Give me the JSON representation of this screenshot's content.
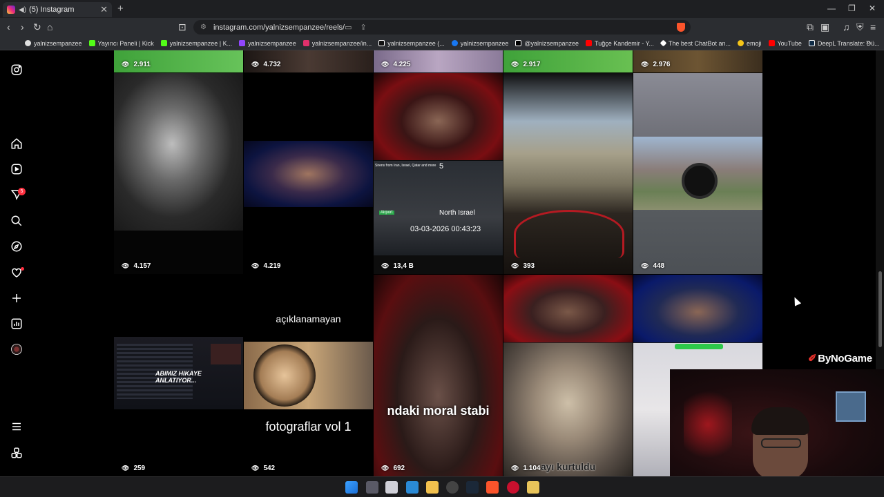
{
  "browser": {
    "tab_title": "(5) Instagram",
    "new_tab": "+",
    "url": "instagram.com/yalnizsempanzee/reels/",
    "window_controls": [
      "—",
      "❐",
      "✕"
    ],
    "bookmarks": [
      {
        "label": "yalnizsempanzee",
        "color": "#e0e0e0"
      },
      {
        "label": "Yayıncı Paneli | Kick",
        "color": "#53fc18"
      },
      {
        "label": "yalnizsempanzee | K...",
        "color": "#53fc18"
      },
      {
        "label": "yalnizsempanzee",
        "color": "#9146ff"
      },
      {
        "label": "yalnizsempanzee/in...",
        "color": "#e1306c"
      },
      {
        "label": "yalnizsempanzee (...",
        "color": "#ffffff"
      },
      {
        "label": "yalnizsempanzee",
        "color": "#1877f2"
      },
      {
        "label": "@yalnizsempanzee",
        "color": "#ffffff"
      },
      {
        "label": "Tuğçe Kandemir - Y...",
        "color": "#ff0000"
      },
      {
        "label": "The best ChatBot an...",
        "color": "#ffffff"
      },
      {
        "label": "emoji",
        "color": "#f5c518"
      },
      {
        "label": "YouTube",
        "color": "#ff0000"
      },
      {
        "label": "DeepL Translate: Dü...",
        "color": "#0f2b46"
      }
    ]
  },
  "sidebar": {
    "notifications_badge": "5",
    "icons": [
      "instagram-logo-icon",
      "home-icon",
      "reels-icon",
      "messages-icon",
      "search-icon",
      "explore-icon",
      "notifications-icon",
      "create-icon",
      "dashboard-icon",
      "profile-icon",
      "menu-icon",
      "also-from-meta-icon"
    ]
  },
  "reels": {
    "row0": [
      "2.911",
      "4.732",
      "4.225",
      "2.917",
      "2.976"
    ],
    "row1": [
      {
        "views": "4.157"
      },
      {
        "views": "4.219"
      },
      {
        "views": "13,4 B",
        "overlay_top": "Sirens from Iran, Israel, Qatar and more",
        "overlay_num": "5",
        "overlay_loc": "North Israel",
        "overlay_time": "03-03-2026 00:43:23",
        "overlay_tag": "Airport"
      },
      {
        "views": "393"
      },
      {
        "views": "448"
      }
    ],
    "row2": [
      {
        "views": "259",
        "caption": "ABIMIZ HIKAYE ANLATIYOR..."
      },
      {
        "views": "542",
        "caption_top": "açıklanamayan",
        "caption_bottom": "fotograflar vol 1"
      },
      {
        "views": "692",
        "caption": "ndaki moral stabi"
      },
      {
        "views": "1.104",
        "caption": "ayı kurtuldu"
      },
      {
        "views": ""
      }
    ]
  },
  "overlay": {
    "brand": "ByNoGame"
  }
}
